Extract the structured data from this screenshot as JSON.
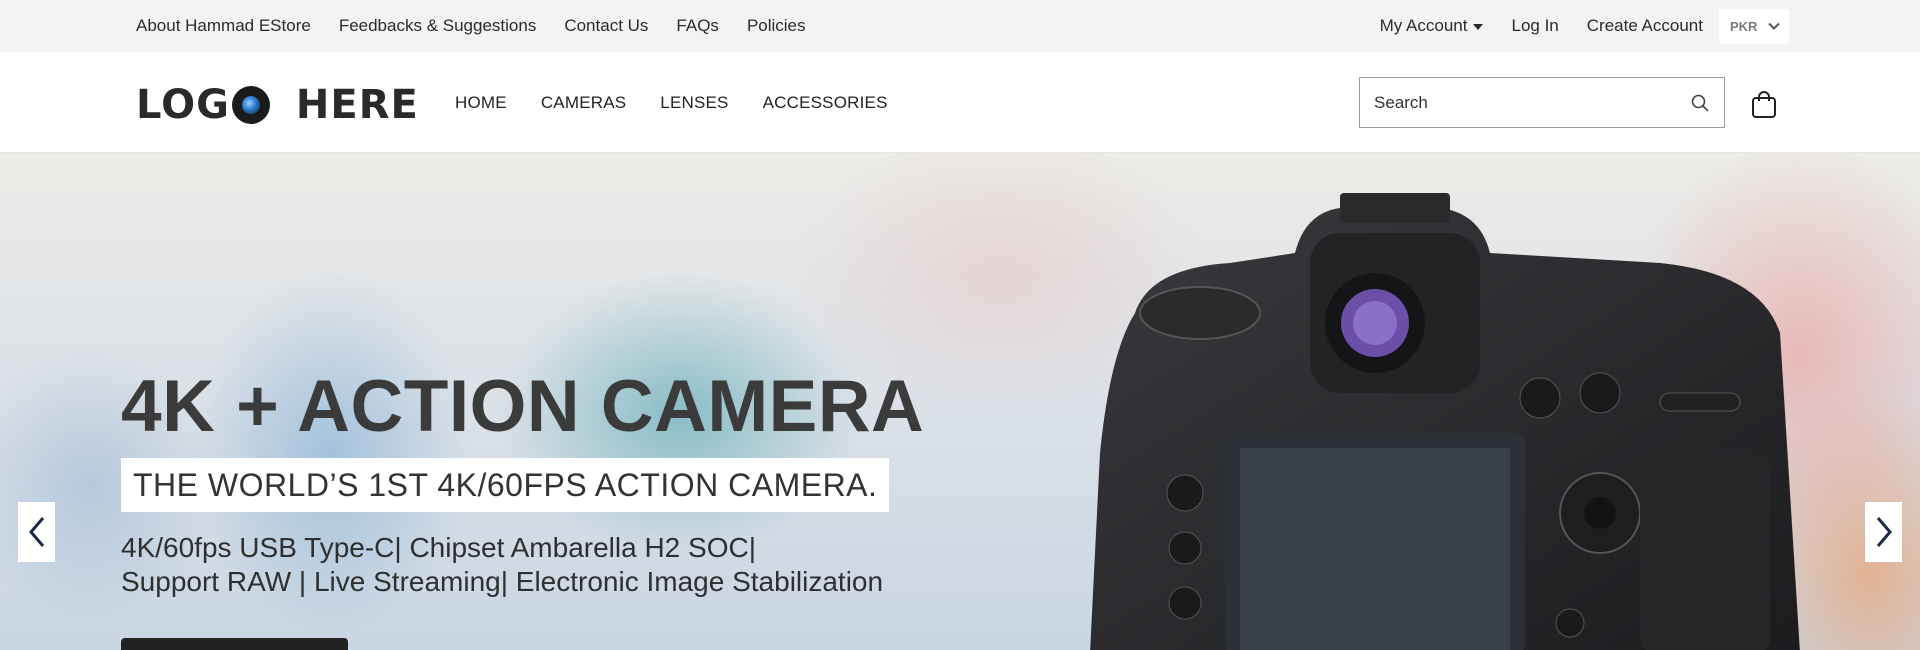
{
  "topbar": {
    "left_links": [
      "About Hammad EStore",
      "Feedbacks & Suggestions",
      "Contact Us",
      "FAQs",
      "Policies"
    ],
    "my_account": "My Account",
    "login": "Log In",
    "create_account": "Create Account",
    "currency": "PKR"
  },
  "header": {
    "logo_left": "LOG",
    "logo_right": "HERE",
    "nav": [
      "HOME",
      "CAMERAS",
      "LENSES",
      "ACCESSORIES"
    ],
    "search_placeholder": "Search"
  },
  "hero": {
    "title": "4K + ACTION CAMERA",
    "tagline": "THE WORLD’S 1ST 4K/60FPS ACTION CAMERA.",
    "desc_line1": "4K/60fps USB Type-C| Chipset Ambarella H2 SOC|",
    "desc_line2": "Support RAW | Live Streaming| Electronic Image Stabilization"
  },
  "icons": {
    "search": "search-icon",
    "cart": "shopping-bag-icon",
    "prev": "chevron-left-icon",
    "next": "chevron-right-icon",
    "caret": "caret-down-icon",
    "currency_caret": "chevron-down-icon"
  }
}
